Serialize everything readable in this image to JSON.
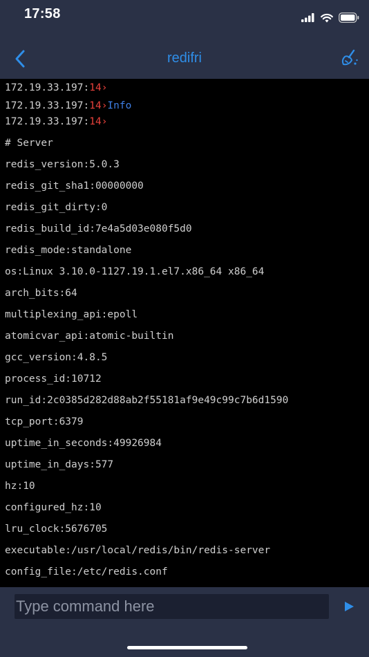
{
  "status": {
    "time": "17:58"
  },
  "nav": {
    "title": "redifri",
    "back_icon": "chevron-left-icon",
    "clear_icon": "broom-icon",
    "accent": "#2f8ee8"
  },
  "console": {
    "prompts": [
      {
        "host": "172.19.33.197:",
        "db": "14",
        "arrow": "›",
        "command": ""
      },
      {
        "host": "172.19.33.197:",
        "db": "14",
        "arrow": "›",
        "command": "Info"
      },
      {
        "host": "172.19.33.197:",
        "db": "14",
        "arrow": "›",
        "command": ""
      }
    ],
    "output": [
      "# Server",
      "redis_version:5.0.3",
      "redis_git_sha1:00000000",
      "redis_git_dirty:0",
      "redis_build_id:7e4a5d03e080f5d0",
      "redis_mode:standalone",
      "os:Linux 3.10.0-1127.19.1.el7.x86_64 x86_64",
      "arch_bits:64",
      "multiplexing_api:epoll",
      "atomicvar_api:atomic-builtin",
      "gcc_version:4.8.5",
      "process_id:10712",
      "run_id:2c0385d282d88ab2f55181af9e49c99c7b6d1590",
      "tcp_port:6379",
      "uptime_in_seconds:49926984",
      "uptime_in_days:577",
      "hz:10",
      "configured_hz:10",
      "lru_clock:5676705",
      "executable:/usr/local/redis/bin/redis-server",
      "config_file:/etc/redis.conf"
    ]
  },
  "input": {
    "placeholder": "Type command here",
    "value": "",
    "send_icon": "send-triangle-icon"
  }
}
